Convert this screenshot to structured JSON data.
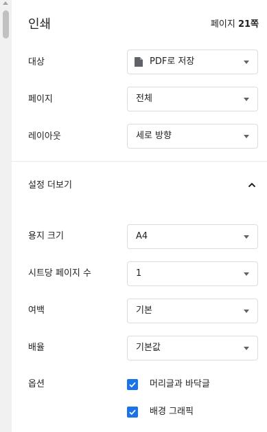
{
  "header": {
    "title": "인쇄",
    "page_count_prefix": "페이지 ",
    "page_count_value": "21쪽"
  },
  "settings": {
    "destination": {
      "label": "대상",
      "value": "PDF로 저장",
      "icon": "document-icon"
    },
    "pages": {
      "label": "페이지",
      "value": "전체"
    },
    "layout": {
      "label": "레이아웃",
      "value": "세로 방향"
    },
    "more_settings": {
      "label": "설정 더보기",
      "icon": "chevron-up-icon"
    },
    "paper_size": {
      "label": "용지 크기",
      "value": "A4"
    },
    "pages_per_sheet": {
      "label": "시트당 페이지 수",
      "value": "1"
    },
    "margins": {
      "label": "여백",
      "value": "기본"
    },
    "scale": {
      "label": "배율",
      "value": "기본값"
    },
    "options": {
      "label": "옵션",
      "headers_footers": {
        "label": "머리글과 바닥글",
        "checked": true
      },
      "background_graphics": {
        "label": "배경 그래픽",
        "checked": true
      }
    }
  },
  "colors": {
    "accent": "#1a73e8",
    "border": "#dadce0",
    "text": "#202124"
  }
}
